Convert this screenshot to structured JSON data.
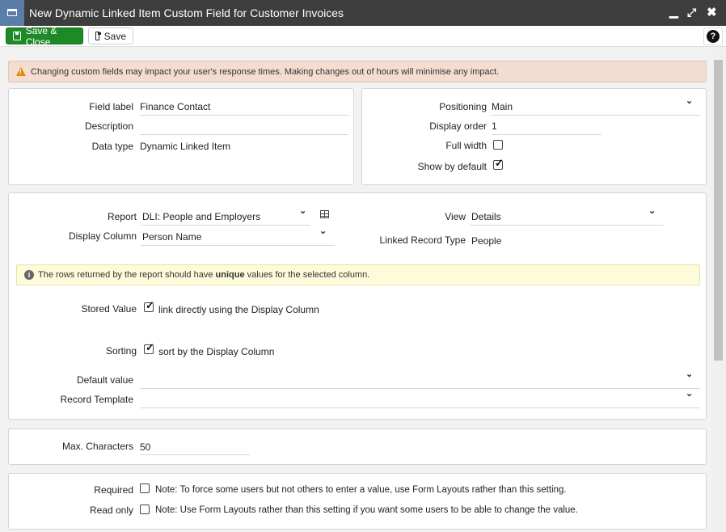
{
  "window": {
    "title": "New Dynamic Linked Item Custom Field for Customer Invoices"
  },
  "toolbar": {
    "save_close_label": "Save & Close",
    "save_label": "Save",
    "help_label": "?"
  },
  "warning": {
    "text": "Changing custom fields may impact your user's response times. Making changes out of hours will minimise any impact."
  },
  "general": {
    "field_label_label": "Field label",
    "field_label_value": "Finance Contact",
    "description_label": "Description",
    "description_value": "",
    "data_type_label": "Data type",
    "data_type_value": "Dynamic Linked Item"
  },
  "placement": {
    "positioning_label": "Positioning",
    "positioning_value": "Main",
    "display_order_label": "Display order",
    "display_order_value": "1",
    "full_width_label": "Full width",
    "full_width_checked": false,
    "show_by_default_label": "Show by default",
    "show_by_default_checked": true
  },
  "linking": {
    "report_label": "Report",
    "report_value": "DLI: People and Employers",
    "display_column_label": "Display Column",
    "display_column_value": "Person Name",
    "view_label": "View",
    "view_value": "Details",
    "linked_record_type_label": "Linked Record Type",
    "linked_record_type_value": "People",
    "info_prefix": "The rows returned by the report should have ",
    "info_bold": "unique",
    "info_suffix": " values for the selected column.",
    "stored_value_label": "Stored Value",
    "stored_value_checked": true,
    "stored_value_text": "link directly using the Display Column",
    "sorting_label": "Sorting",
    "sorting_checked": true,
    "sorting_text": "sort by the Display Column",
    "default_value_label": "Default value",
    "default_value_value": "",
    "record_template_label": "Record Template",
    "record_template_value": ""
  },
  "limits": {
    "max_characters_label": "Max. Characters",
    "max_characters_value": "50"
  },
  "flags": {
    "required_label": "Required",
    "required_checked": false,
    "required_note": "Note: To force some users but not others to enter a value, use Form Layouts rather than this setting.",
    "read_only_label": "Read only",
    "read_only_checked": false,
    "read_only_note": "Note: Use Form Layouts rather than this setting if you want some users to be able to change the value."
  },
  "colors": {
    "title_bar": "#3d3d3d",
    "window_icon": "#5b7ea8",
    "save_close_button": "#1e8a27",
    "warning_background": "#f2ddd0",
    "warning_icon": "#e08a12",
    "info_background": "#fdfbd9"
  },
  "icons": {
    "window": "window-icon",
    "minimize": "minimize-icon",
    "maximize": "maximize-icon",
    "close": "close-icon",
    "save": "floppy-disk-icon",
    "warning": "warning-triangle-icon",
    "info": "info-circle-icon",
    "report_picker": "table-grid-icon",
    "dropdown": "chevron-down-icon"
  }
}
